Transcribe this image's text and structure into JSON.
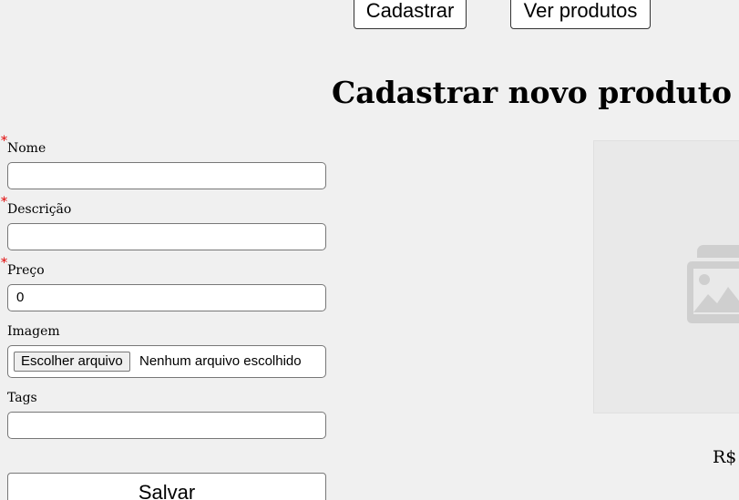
{
  "nav": {
    "cadastrar_label": "Cadastrar",
    "ver_produtos_label": "Ver produtos"
  },
  "page": {
    "title": "Cadastrar novo produto"
  },
  "form": {
    "required_marker": "*",
    "nome": {
      "label": "Nome",
      "value": "",
      "required": true
    },
    "descricao": {
      "label": "Descrição",
      "value": "",
      "required": true
    },
    "preco": {
      "label": "Preço",
      "value": "0",
      "required": true
    },
    "imagem": {
      "label": "Imagem",
      "button_label": "Escolher arquivo",
      "status": "Nenhum arquivo escolhido"
    },
    "tags": {
      "label": "Tags",
      "value": ""
    },
    "save_label": "Salvar"
  },
  "preview": {
    "icon": "image-placeholder-icon",
    "currency": "R$"
  },
  "colors": {
    "background": "#f0f0f0",
    "required_marker": "#e00000",
    "preview_bg": "#e9e9e9",
    "placeholder_icon": "#cfcfcf"
  }
}
